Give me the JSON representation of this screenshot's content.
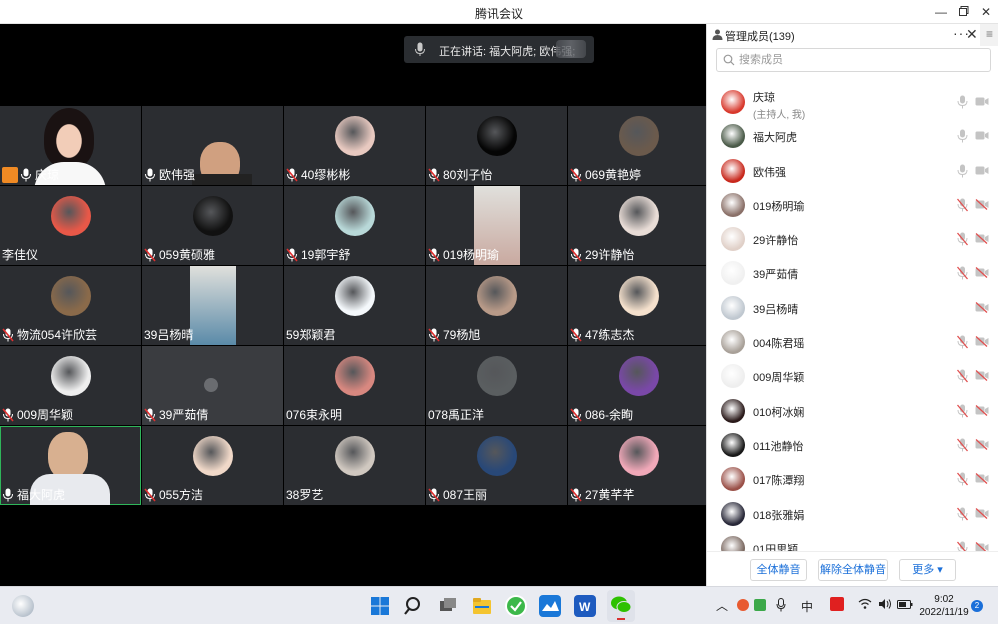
{
  "window": {
    "title": "腾讯会议"
  },
  "speaking": {
    "text": "正在讲话: 福大阿虎; 欧伟强;"
  },
  "tiles": [
    {
      "name": "庆琼",
      "kind": "video-woman",
      "host": true,
      "mic": "on"
    },
    {
      "name": "欧伟强",
      "kind": "video-man",
      "mic": "on"
    },
    {
      "name": "40缪彬彬",
      "kind": "avatar",
      "color": "#e8c9c0",
      "mic": "off"
    },
    {
      "name": "80刘子怡",
      "kind": "avatar",
      "color": "#050505",
      "mic": "off"
    },
    {
      "name": "069黄艳婷",
      "kind": "avatar",
      "color": "#6b5a4c",
      "mic": "off"
    },
    {
      "name": "李佳仪",
      "kind": "avatar",
      "color": "#e85848",
      "mic": "none"
    },
    {
      "name": "059黄硕雅",
      "kind": "avatar",
      "color": "#111111",
      "mic": "off"
    },
    {
      "name": "19郭宇舒",
      "kind": "avatar",
      "color": "#b8d8d8",
      "mic": "off"
    },
    {
      "name": "019杨明瑜",
      "kind": "vertical",
      "color": "#c9a9a0",
      "mic": "off"
    },
    {
      "name": "29许静怡",
      "kind": "avatar",
      "color": "#e8dcd6",
      "mic": "off"
    },
    {
      "name": "物流054许欣芸",
      "kind": "avatar",
      "color": "#8a6a4a",
      "mic": "off"
    },
    {
      "name": "39吕杨晴",
      "kind": "vertical",
      "color": "#5a8aa8",
      "mic": "none"
    },
    {
      "name": "59郑颖君",
      "kind": "avatar",
      "color": "#f4f8fb",
      "mic": "none"
    },
    {
      "name": "79杨旭",
      "kind": "avatar",
      "color": "#b89a88",
      "mic": "off"
    },
    {
      "name": "47练志杰",
      "kind": "avatar",
      "color": "#f4e0cc",
      "mic": "off"
    },
    {
      "name": "009周华颖",
      "kind": "avatar",
      "color": "#eeeeee",
      "mic": "off"
    },
    {
      "name": "39严茹倩",
      "kind": "blank",
      "color": "#3a3c40",
      "mic": "off"
    },
    {
      "name": "076束永明",
      "kind": "avatar",
      "color": "#d88880",
      "mic": "none"
    },
    {
      "name": "078禹正洋",
      "kind": "avatar",
      "color": "#5a5e60",
      "mic": "none"
    },
    {
      "name": "086-余眴",
      "kind": "avatar",
      "color": "#7a48a8",
      "mic": "off"
    },
    {
      "name": "福大阿虎",
      "kind": "video-man2",
      "mic": "on"
    },
    {
      "name": "055方洁",
      "kind": "avatar",
      "color": "#f0d8c8",
      "mic": "off"
    },
    {
      "name": "38罗艺",
      "kind": "avatar",
      "color": "#d0c8c0",
      "mic": "none"
    },
    {
      "name": "087王丽",
      "kind": "avatar",
      "color": "#284878",
      "mic": "off"
    },
    {
      "name": "27黄芊芊",
      "kind": "avatar",
      "color": "#f0a8b8",
      "mic": "off"
    }
  ],
  "panel": {
    "title": "管理成员(139)",
    "more_label": "···",
    "close_label": "✕",
    "side_label": "≡",
    "search_placeholder": "搜索成员",
    "members": [
      {
        "name": "庆琼",
        "sub": "(主持人, 我)",
        "color": "#d8382c",
        "mic": "on",
        "cam": "on"
      },
      {
        "name": "福大阿虎",
        "color": "#4a5a48",
        "mic": "on",
        "cam": "on"
      },
      {
        "name": "欧伟强",
        "color": "#c8281c",
        "mic": "on",
        "cam": "on"
      },
      {
        "name": "019杨明瑜",
        "color": "#8a7068",
        "mic": "off",
        "cam": "off"
      },
      {
        "name": "29许静怡",
        "color": "#e0d0c8",
        "mic": "off",
        "cam": "off"
      },
      {
        "name": "39严茹倩",
        "color": "#f0f0f0",
        "mic": "off",
        "cam": "off"
      },
      {
        "name": "39吕杨晴",
        "color": "#c0c8d0",
        "mic": "none",
        "cam": "off"
      },
      {
        "name": "004陈君瑶",
        "color": "#a8a098",
        "mic": "off",
        "cam": "off"
      },
      {
        "name": "009周华颖",
        "color": "#eeeeee",
        "mic": "off",
        "cam": "off"
      },
      {
        "name": "010柯冰娴",
        "color": "#2a1a1a",
        "mic": "off",
        "cam": "off"
      },
      {
        "name": "011池静怡",
        "color": "#181818",
        "mic": "off",
        "cam": "off"
      },
      {
        "name": "017陈潭翔",
        "color": "#9a5048",
        "mic": "off",
        "cam": "off"
      },
      {
        "name": "018张雅娟",
        "color": "#282838",
        "mic": "off",
        "cam": "off"
      },
      {
        "name": "01田思颖",
        "color": "#7a6860",
        "mic": "off",
        "cam": "off"
      }
    ],
    "footer": {
      "mute_all": "全体静音",
      "unmute_all": "解除全体静音",
      "more": "更多 ▾"
    }
  },
  "taskbar": {
    "ime": "中",
    "time": "9:02",
    "date": "2022/11/19",
    "notifications": "2"
  }
}
